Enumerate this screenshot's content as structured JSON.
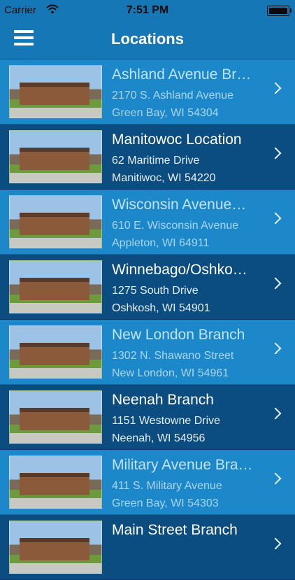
{
  "status_bar": {
    "carrier": "Carrier",
    "time": "7:51 PM"
  },
  "nav": {
    "title": "Locations"
  },
  "locations": [
    {
      "name": "Ashland Avenue Br…",
      "address_line1": "2170 S. Ashland Avenue",
      "address_line2": "Green Bay, WI 54304"
    },
    {
      "name": "Manitowoc Location",
      "address_line1": "62 Maritime Drive",
      "address_line2": "Manitiwoc, WI 54220"
    },
    {
      "name": "Wisconsin Avenue…",
      "address_line1": "610 E. Wisconsin Avenue",
      "address_line2": "Appleton, WI 64911"
    },
    {
      "name": "Winnebago/Oshko…",
      "address_line1": "1275 South Drive",
      "address_line2": "Oshkosh, WI 54901"
    },
    {
      "name": "New London Branch",
      "address_line1": "1302 N. Shawano Street",
      "address_line2": "New London, WI 54961"
    },
    {
      "name": "Neenah Branch",
      "address_line1": "1151 Westowne Drive",
      "address_line2": "Neenah, WI 54956"
    },
    {
      "name": "Military Avenue Bra…",
      "address_line1": "411 S. Military Avenue",
      "address_line2": "Green Bay, WI 54303"
    },
    {
      "name": "Main Street Branch",
      "address_line1": "",
      "address_line2": ""
    }
  ]
}
